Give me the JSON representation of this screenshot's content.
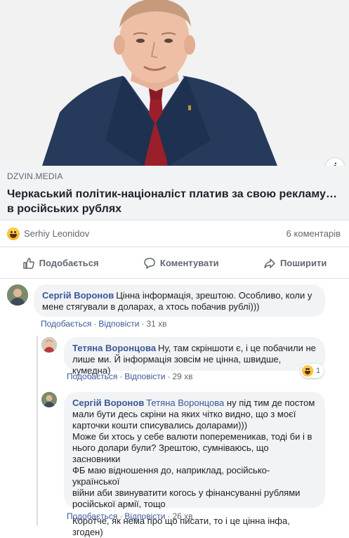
{
  "link_preview": {
    "domain": "DZVIN.MEDIA",
    "title_line1": "Черкаський політик-націоналіст платив за свою рекламу…",
    "title_line2": "в російських рублях",
    "info_label": "i"
  },
  "post_stats": {
    "reactor_name": "Serhiy Leonidov",
    "reaction_icon": "laugh-emoji-icon",
    "comments_count": "6 коментарів"
  },
  "actions": {
    "like": "Подобається",
    "comment": "Коментувати",
    "share": "Поширити"
  },
  "comments": [
    {
      "author": "Сергій Воронов",
      "text_line1": "Цінна інформація, зрештою. Особливо, коли у",
      "text_line2": "мене стягували в доларах, а хтось побачив рублі)))",
      "like": "Подобається",
      "reply": "Відповісти",
      "time": "31 хв"
    }
  ],
  "replies": [
    {
      "author": "Тетяна Воронцова",
      "text_line1": "Ну, там скріншоти є, і це побачили не",
      "text_line2": "лише ми. Й інформація зовсім не цінна, швидше, кумедна)",
      "like": "Подобається",
      "reply": "Відповісти",
      "time": "29 хв",
      "reaction_count": "1"
    },
    {
      "author": "Сергій Воронов",
      "mention": "Тетяна Воронцова",
      "text_line1_rest": "ну під тим де постом",
      "text_line2": "мали бути десь скріни на яких чітко видно, що з моєї",
      "text_line3": "карточки кошти списувались доларами)))",
      "text_line4": "Може би хтось у себе валюти попеременикав, тоді би і в",
      "text_line5": "нього долари були? Зрештою, сумніваюсь, що засновники",
      "text_line6": "ФБ маю відношення до, наприклад, російсько-української",
      "text_line7": "війни аби звинуватити когось у фінансуванні рублями",
      "text_line8": "російської армії, тощо",
      "text_line9": "Коротче, як нема про що писати, то і це цінна інфа, згоден)",
      "like": "Подобається",
      "reply": "Відповісти",
      "time": "26 хв"
    }
  ],
  "colors": {
    "link_blue": "#385898",
    "bubble_bg": "#f2f3f5",
    "meta_gray": "#606770"
  }
}
